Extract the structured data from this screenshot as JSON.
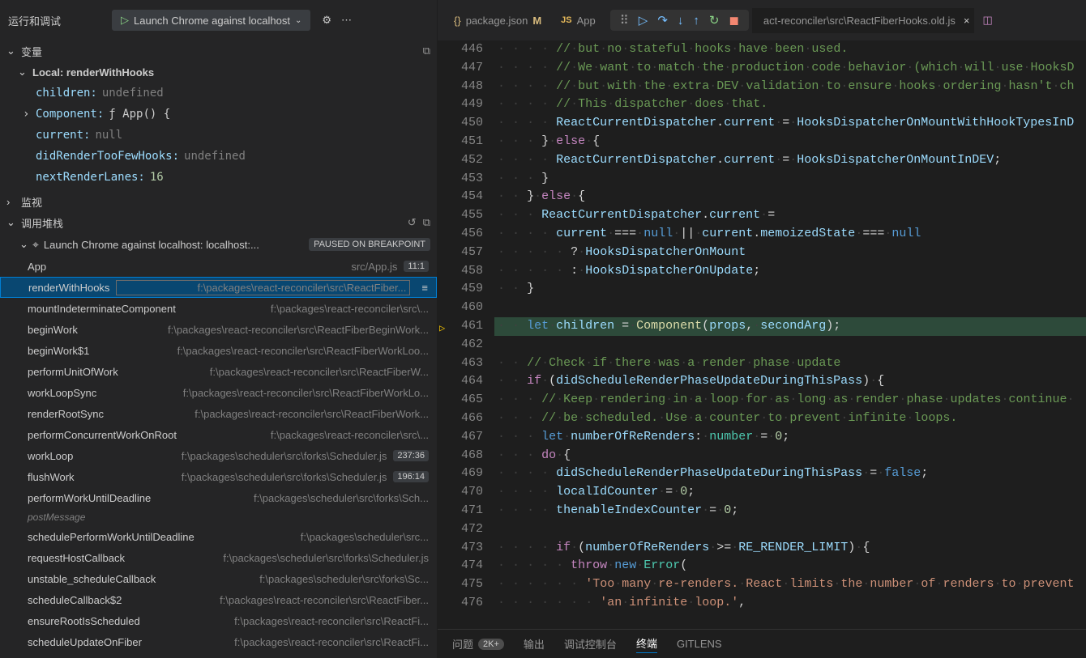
{
  "topBar": {
    "title": "运行和调试",
    "launchLabel": "Launch Chrome against localhost"
  },
  "variables": {
    "header": "变量",
    "scopeLabel": "Local: renderWithHooks",
    "rows": [
      {
        "name": "children:",
        "value": "undefined",
        "cls": "var-value"
      },
      {
        "name": "Component:",
        "value": "ƒ App() {",
        "cls": "var-func",
        "hasChev": true
      },
      {
        "name": "current:",
        "value": "null",
        "cls": "var-value"
      },
      {
        "name": "didRenderTooFewHooks:",
        "value": "undefined",
        "cls": "var-value"
      },
      {
        "name": "nextRenderLanes:",
        "value": "16",
        "cls": "var-num"
      }
    ]
  },
  "watch": {
    "header": "监视"
  },
  "callStack": {
    "header": "调用堆栈",
    "launchLabel": "Launch Chrome against localhost: localhost:...",
    "pausedLabel": "PAUSED ON BREAKPOINT",
    "postMessage": "postMessage",
    "frames": [
      {
        "fn": "App",
        "path": "src/App.js",
        "line": "11:1"
      },
      {
        "fn": "renderWithHooks",
        "path": "f:\\packages\\react-reconciler\\src\\ReactFiber...",
        "selected": true,
        "boxed": true
      },
      {
        "fn": "mountIndeterminateComponent",
        "path": "f:\\packages\\react-reconciler\\src\\..."
      },
      {
        "fn": "beginWork",
        "path": "f:\\packages\\react-reconciler\\src\\ReactFiberBeginWork..."
      },
      {
        "fn": "beginWork$1",
        "path": "f:\\packages\\react-reconciler\\src\\ReactFiberWorkLoo..."
      },
      {
        "fn": "performUnitOfWork",
        "path": "f:\\packages\\react-reconciler\\src\\ReactFiberW..."
      },
      {
        "fn": "workLoopSync",
        "path": "f:\\packages\\react-reconciler\\src\\ReactFiberWorkLo..."
      },
      {
        "fn": "renderRootSync",
        "path": "f:\\packages\\react-reconciler\\src\\ReactFiberWork..."
      },
      {
        "fn": "performConcurrentWorkOnRoot",
        "path": "f:\\packages\\react-reconciler\\src\\..."
      },
      {
        "fn": "workLoop",
        "path": "f:\\packages\\scheduler\\src\\forks\\Scheduler.js",
        "line": "237:36"
      },
      {
        "fn": "flushWork",
        "path": "f:\\packages\\scheduler\\src\\forks\\Scheduler.js",
        "line": "196:14"
      },
      {
        "fn": "performWorkUntilDeadline",
        "path": "f:\\packages\\scheduler\\src\\forks\\Sch..."
      },
      {
        "_postMsg": true
      },
      {
        "fn": "schedulePerformWorkUntilDeadline",
        "path": "f:\\packages\\scheduler\\src..."
      },
      {
        "fn": "requestHostCallback",
        "path": "f:\\packages\\scheduler\\src\\forks\\Scheduler.js"
      },
      {
        "fn": "unstable_scheduleCallback",
        "path": "f:\\packages\\scheduler\\src\\forks\\Sc..."
      },
      {
        "fn": "scheduleCallback$2",
        "path": "f:\\packages\\react-reconciler\\src\\ReactFiber..."
      },
      {
        "fn": "ensureRootIsScheduled",
        "path": "f:\\packages\\react-reconciler\\src\\ReactFi..."
      },
      {
        "fn": "scheduleUpdateOnFiber",
        "path": "f:\\packages\\react-reconciler\\src\\ReactFi..."
      }
    ]
  },
  "tabs": {
    "t1": "package.json",
    "t1mod": "M",
    "t2": "App",
    "activePath": "act-reconciler\\src\\ReactFiberHooks.old.js"
  },
  "editor": {
    "startLine": 446,
    "breakpointAt": 461,
    "lines": [
      {
        "indent": 4,
        "tokens": [
          [
            "tok-comment",
            "// but no stateful hooks have been used."
          ]
        ]
      },
      {
        "indent": 4,
        "tokens": [
          [
            "tok-comment",
            "// We want to match the production code behavior (which will use HooksD"
          ]
        ]
      },
      {
        "indent": 4,
        "tokens": [
          [
            "tok-comment",
            "// but with the extra DEV validation to ensure hooks ordering hasn't ch"
          ]
        ]
      },
      {
        "indent": 4,
        "tokens": [
          [
            "tok-comment",
            "// This dispatcher does that."
          ]
        ]
      },
      {
        "indent": 4,
        "tokens": [
          [
            "tok-var",
            "ReactCurrentDispatcher"
          ],
          [
            "tok-punct",
            "."
          ],
          [
            "tok-prop",
            "current"
          ],
          [
            "tok-punct",
            " = "
          ],
          [
            "tok-var",
            "HooksDispatcherOnMountWithHookTypesInD"
          ]
        ]
      },
      {
        "indent": 3,
        "tokens": [
          [
            "tok-punct",
            "} "
          ],
          [
            "tok-keyword2",
            "else"
          ],
          [
            "tok-punct",
            " {"
          ]
        ]
      },
      {
        "indent": 4,
        "tokens": [
          [
            "tok-var",
            "ReactCurrentDispatcher"
          ],
          [
            "tok-punct",
            "."
          ],
          [
            "tok-prop",
            "current"
          ],
          [
            "tok-punct",
            " = "
          ],
          [
            "tok-var",
            "HooksDispatcherOnMountInDEV"
          ],
          [
            "tok-punct",
            ";"
          ]
        ]
      },
      {
        "indent": 3,
        "tokens": [
          [
            "tok-punct",
            "}"
          ]
        ]
      },
      {
        "indent": 2,
        "tokens": [
          [
            "tok-punct",
            "} "
          ],
          [
            "tok-keyword2",
            "else"
          ],
          [
            "tok-punct",
            " {"
          ]
        ]
      },
      {
        "indent": 3,
        "tokens": [
          [
            "tok-var",
            "ReactCurrentDispatcher"
          ],
          [
            "tok-punct",
            "."
          ],
          [
            "tok-prop",
            "current"
          ],
          [
            "tok-punct",
            " ="
          ]
        ]
      },
      {
        "indent": 4,
        "tokens": [
          [
            "tok-var",
            "current"
          ],
          [
            "tok-punct",
            " === "
          ],
          [
            "tok-null",
            "null"
          ],
          [
            "tok-punct",
            " || "
          ],
          [
            "tok-var",
            "current"
          ],
          [
            "tok-punct",
            "."
          ],
          [
            "tok-prop",
            "memoizedState"
          ],
          [
            "tok-punct",
            " === "
          ],
          [
            "tok-null",
            "null"
          ]
        ]
      },
      {
        "indent": 5,
        "tokens": [
          [
            "tok-punct",
            "? "
          ],
          [
            "tok-var",
            "HooksDispatcherOnMount"
          ]
        ]
      },
      {
        "indent": 5,
        "tokens": [
          [
            "tok-punct",
            ": "
          ],
          [
            "tok-var",
            "HooksDispatcherOnUpdate"
          ],
          [
            "tok-punct",
            ";"
          ]
        ]
      },
      {
        "indent": 2,
        "tokens": [
          [
            "tok-punct",
            "}"
          ]
        ]
      },
      {
        "indent": 0,
        "tokens": []
      },
      {
        "indent": 2,
        "hl": true,
        "tokens": [
          [
            "tok-keyword",
            "let"
          ],
          [
            "tok-punct",
            " "
          ],
          [
            "tok-var",
            "children"
          ],
          [
            "tok-punct",
            " = "
          ],
          [
            "tok-func",
            "Component"
          ],
          [
            "tok-punct",
            "("
          ],
          [
            "tok-var",
            "props"
          ],
          [
            "tok-punct",
            ", "
          ],
          [
            "tok-var",
            "secondArg"
          ],
          [
            "tok-punct",
            ");"
          ]
        ]
      },
      {
        "indent": 0,
        "tokens": []
      },
      {
        "indent": 2,
        "tokens": [
          [
            "tok-comment",
            "// Check if there was a render phase update"
          ]
        ]
      },
      {
        "indent": 2,
        "tokens": [
          [
            "tok-keyword2",
            "if"
          ],
          [
            "tok-punct",
            " ("
          ],
          [
            "tok-var",
            "didScheduleRenderPhaseUpdateDuringThisPass"
          ],
          [
            "tok-punct",
            ") {"
          ]
        ]
      },
      {
        "indent": 3,
        "tokens": [
          [
            "tok-comment",
            "// Keep rendering in a loop for as long as render phase updates continue "
          ]
        ]
      },
      {
        "indent": 3,
        "tokens": [
          [
            "tok-comment",
            "// be scheduled. Use a counter to prevent infinite loops."
          ]
        ]
      },
      {
        "indent": 3,
        "tokens": [
          [
            "tok-keyword",
            "let"
          ],
          [
            "tok-punct",
            " "
          ],
          [
            "tok-var",
            "numberOfReRenders"
          ],
          [
            "tok-punct",
            ": "
          ],
          [
            "tok-type",
            "number"
          ],
          [
            "tok-punct",
            " = "
          ],
          [
            "tok-number",
            "0"
          ],
          [
            "tok-punct",
            ";"
          ]
        ]
      },
      {
        "indent": 3,
        "tokens": [
          [
            "tok-keyword2",
            "do"
          ],
          [
            "tok-punct",
            " {"
          ]
        ]
      },
      {
        "indent": 4,
        "tokens": [
          [
            "tok-var",
            "didScheduleRenderPhaseUpdateDuringThisPass"
          ],
          [
            "tok-punct",
            " = "
          ],
          [
            "tok-null",
            "false"
          ],
          [
            "tok-punct",
            ";"
          ]
        ]
      },
      {
        "indent": 4,
        "tokens": [
          [
            "tok-var",
            "localIdCounter"
          ],
          [
            "tok-punct",
            " = "
          ],
          [
            "tok-number",
            "0"
          ],
          [
            "tok-punct",
            ";"
          ]
        ]
      },
      {
        "indent": 4,
        "tokens": [
          [
            "tok-var",
            "thenableIndexCounter"
          ],
          [
            "tok-punct",
            " = "
          ],
          [
            "tok-number",
            "0"
          ],
          [
            "tok-punct",
            ";"
          ]
        ]
      },
      {
        "indent": 0,
        "tokens": []
      },
      {
        "indent": 4,
        "tokens": [
          [
            "tok-keyword2",
            "if"
          ],
          [
            "tok-punct",
            " ("
          ],
          [
            "tok-var",
            "numberOfReRenders"
          ],
          [
            "tok-punct",
            " >= "
          ],
          [
            "tok-var",
            "RE_RENDER_LIMIT"
          ],
          [
            "tok-punct",
            ") {"
          ]
        ]
      },
      {
        "indent": 5,
        "tokens": [
          [
            "tok-keyword2",
            "throw"
          ],
          [
            "tok-punct",
            " "
          ],
          [
            "tok-keyword",
            "new"
          ],
          [
            "tok-punct",
            " "
          ],
          [
            "tok-type",
            "Error"
          ],
          [
            "tok-punct",
            "("
          ]
        ]
      },
      {
        "indent": 6,
        "tokens": [
          [
            "tok-string",
            "'Too many re-renders. React limits the number of renders to prevent"
          ]
        ]
      },
      {
        "indent": 7,
        "tokens": [
          [
            "tok-string",
            "'an infinite loop.'"
          ],
          [
            "tok-punct",
            ","
          ]
        ]
      }
    ]
  },
  "bottom": {
    "problems": "问题",
    "problemsCount": "2K+",
    "output": "输出",
    "debugConsole": "调试控制台",
    "terminal": "终端",
    "gitlens": "GITLENS"
  }
}
